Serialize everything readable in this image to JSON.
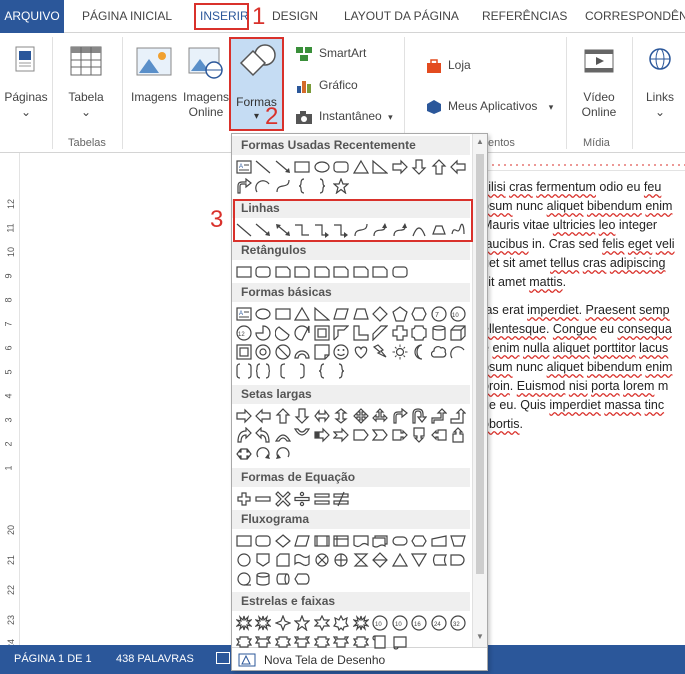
{
  "tabs": [
    {
      "label": "ARQUIVO"
    },
    {
      "label": "PÁGINA INICIAL"
    },
    {
      "label": "INSERIR"
    },
    {
      "label": "DESIGN"
    },
    {
      "label": "LAYOUT DA PÁGINA"
    },
    {
      "label": "REFERÊNCIAS"
    },
    {
      "label": "CORRESPONDÊNC"
    }
  ],
  "steps": {
    "one": "1",
    "two": "2",
    "three": "3"
  },
  "ribbon": {
    "paginas": "Páginas",
    "tabela": "Tabela",
    "tabelas_group": "Tabelas",
    "imagens": "Imagens",
    "imagens_online_1": "Imagens",
    "imagens_online_2": "Online",
    "formas": "Formas",
    "smartart": "SmartArt",
    "grafico": "Gráfico",
    "instantaneo": "Instantâneo",
    "loja": "Loja",
    "meus_aplicativos": "Meus Aplicativos",
    "apps_group_partial": "entos",
    "video_online_1": "Vídeo",
    "video_online_2": "Online",
    "midia_group": "Mídia",
    "links": "Links"
  },
  "vruler_numbers": [
    "12",
    "11",
    "10",
    "9",
    "8",
    "7",
    "6",
    "5",
    "4",
    "3",
    "2",
    "1",
    "20",
    "21",
    "22",
    "23",
    "24"
  ],
  "document": {
    "para1": [
      "cilisi cras fermentum odio eu feu",
      "psum nunc aliquet bibendum enim",
      " Mauris vitae ultricies leo integer",
      "faucibus in. Cras sed felis eget veli",
      "get sit amet tellus cras adipiscing",
      " sit amet mattis."
    ],
    "para2": [
      "tas erat imperdiet. Praesent semp",
      "ellentesque. Congue eu consequa",
      "e enim nulla aliquet porttitor lacus",
      "psum nunc aliquet bibendum enim",
      "proin. Euismod nisi porta lorem m",
      "ue eu. Quis imperdiet massa tinc",
      "obortis."
    ]
  },
  "status": {
    "page": "PÁGINA 1 DE 1",
    "words": "438 PALAVRAS"
  },
  "dropdown": {
    "sections": [
      "Formas Usadas Recentemente",
      "Linhas",
      "Retângulos",
      "Formas básicas",
      "Setas largas",
      "Formas de Equação",
      "Fluxograma",
      "Estrelas e faixas"
    ],
    "new_canvas": "Nova Tela de Desenho"
  },
  "colors": {
    "accent": "#2b579a",
    "highlight_box": "#d9312b",
    "spell_underline": "#d9312b"
  }
}
